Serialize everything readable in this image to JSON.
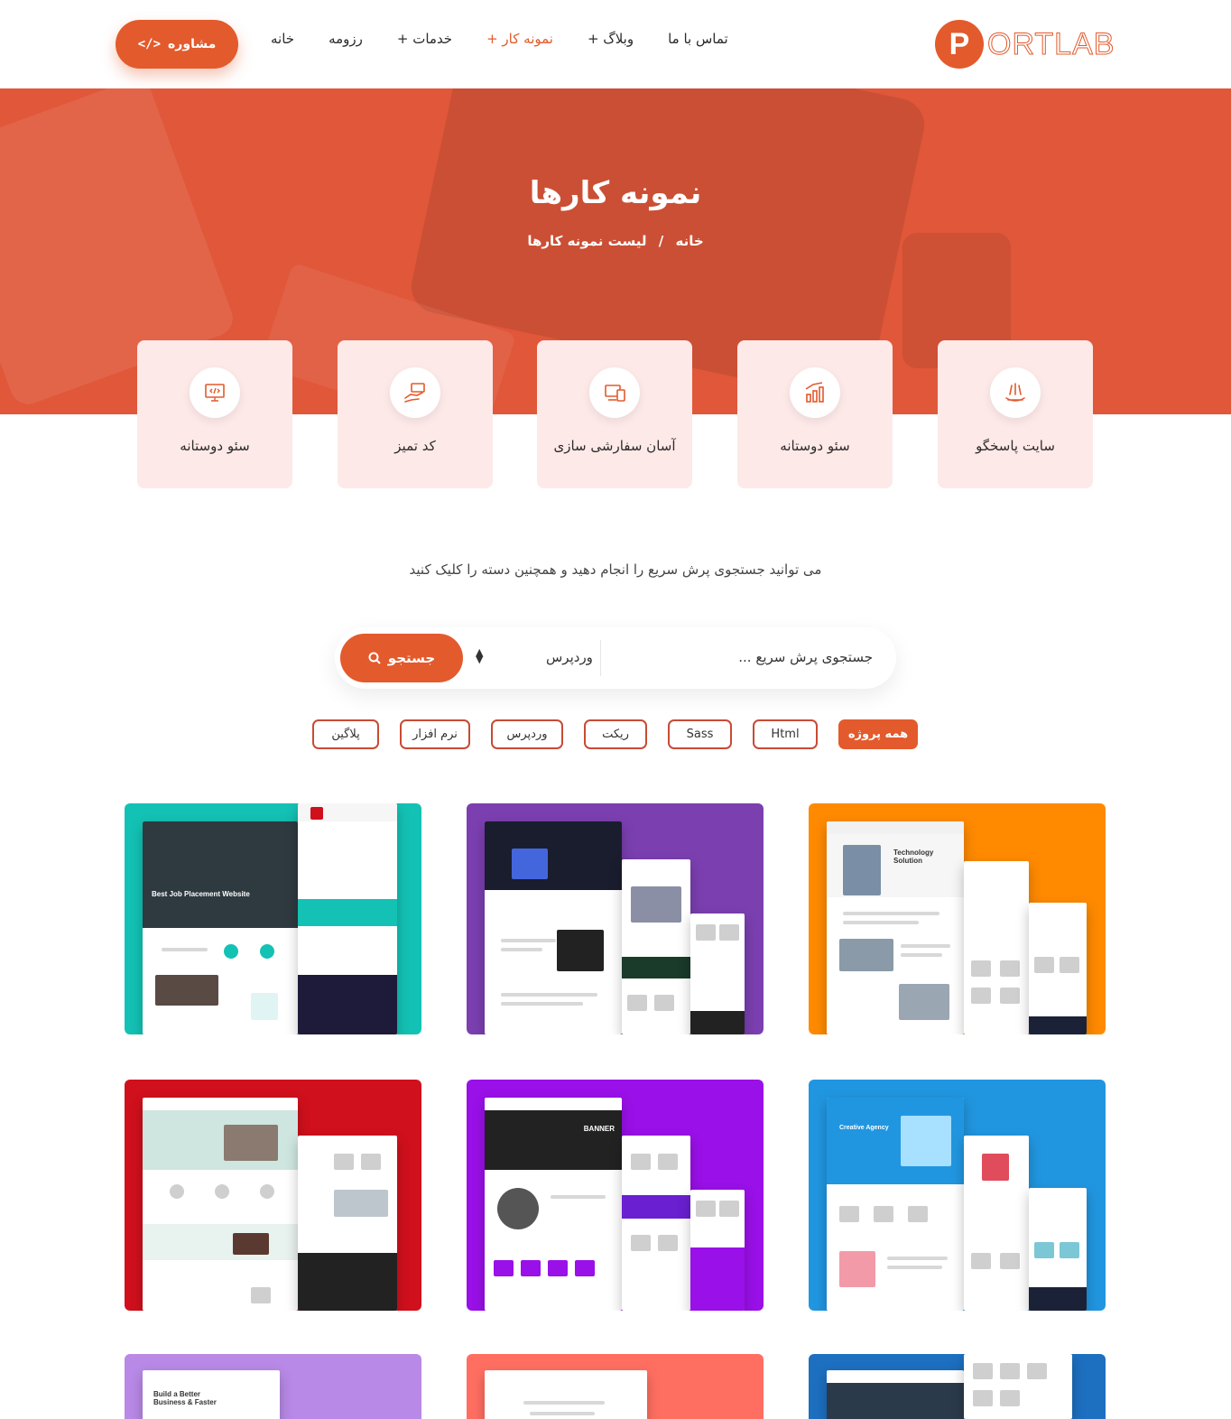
{
  "header": {
    "logo_letter": "P",
    "logo_text": "ORTLAB",
    "nav": [
      "خانه",
      "رزومه",
      "خدمات +",
      "نمونه کار +",
      "وبلاگ +",
      "تماس با ما"
    ],
    "consult_label": "مشاوره",
    "consult_icon": "code-icon",
    "accent_color": "#e35a2c"
  },
  "hero": {
    "title": "نمونه کارها",
    "breadcrumb_home": "خانه",
    "breadcrumb_sep": "/",
    "breadcrumb_current": "لیست نمونه کارها"
  },
  "features": [
    {
      "label": "سایت پاسخگو",
      "icon": "hand-flower-icon"
    },
    {
      "label": "سئو دوستانه",
      "icon": "chart-bar-icon"
    },
    {
      "label": "آسان سفارشی سازی",
      "icon": "devices-icon"
    },
    {
      "label": "کد تمیز",
      "icon": "hand-cash-icon"
    },
    {
      "label": "سئو دوستانه",
      "icon": "monitor-code-icon"
    }
  ],
  "search": {
    "subtitle": "می توانید جستجوی پرش سریع را انجام دهید و همچنین دسته را کلیک کنید",
    "placeholder": "جستجوی پرش سریع ...",
    "category_selected": "وردپرس",
    "button_label": "جستجو",
    "button_icon": "search-icon"
  },
  "filters": [
    "همه پروژه",
    "Html",
    "Sass",
    "ریکت",
    "وردپرس",
    "نرم افزار",
    "پلاگین"
  ],
  "filters_active_index": 0,
  "portfolio_colors": [
    "#ff8a00",
    "#7b3fb0",
    "#13c2b4",
    "#2196e0",
    "#9a10e8",
    "#d0101c",
    "#1d6fc0",
    "#ff6f61",
    "#b889e6"
  ],
  "portfolio_texts": {
    "tile3_headline": "Best Job Placement Website",
    "tile1_headline": "Technology Solution",
    "tile4_headline": "Creative Agency",
    "tile5_headline": "BANNER",
    "tile9_headline": "Build a Better Business & Faster"
  }
}
